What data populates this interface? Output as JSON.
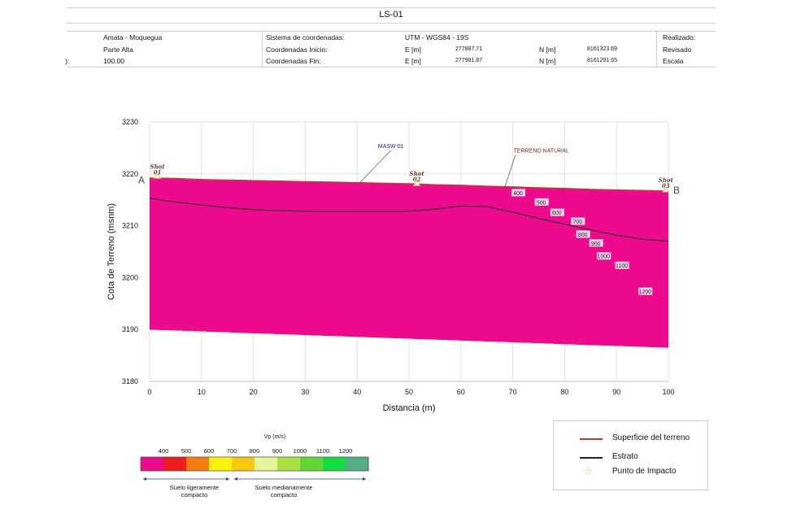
{
  "header": {
    "title": "LS-01",
    "rows": [
      {
        "c1": "",
        "c2": "Amata - Moquegua",
        "c3": "Sistema de coordenadas:",
        "c4": "UTM - WGS84 - 19S",
        "c5": "",
        "c6": "",
        "c7": "",
        "c8": "Realizado:"
      },
      {
        "c1": "",
        "c2": "Parte Alta",
        "c3": "Coordenadas Inicio:",
        "c4": "E [m]",
        "c5": "277887.71",
        "c6": "N [m]",
        "c7": "8161323.69",
        "c8": "Revisado"
      },
      {
        "c1": "):",
        "c2": "100.00",
        "c3": "Coordenadas Fin:",
        "c4": "E [m]",
        "c5": "277981.87",
        "c6": "N [m]",
        "c7": "8161291.65",
        "c8": "Escala"
      }
    ]
  },
  "chart_data": {
    "type": "area",
    "xlabel": "Distancia (m)",
    "ylabel": "Cota de Terreno (msnm)",
    "xlim": [
      0,
      100
    ],
    "ylim": [
      3180,
      3230
    ],
    "x_ticks": [
      "0",
      "10",
      "20",
      "30",
      "40",
      "50",
      "60",
      "70",
      "80",
      "90",
      "100"
    ],
    "y_ticks": [
      "3180",
      "3190",
      "3200",
      "3210",
      "3220",
      "3230"
    ],
    "grid": true,
    "x": [
      0,
      5,
      10,
      15,
      20,
      25,
      30,
      35,
      40,
      45,
      50,
      55,
      60,
      65,
      70,
      75,
      80,
      85,
      90,
      95,
      100
    ],
    "surface": [
      3219.2,
      3219.1,
      3218.9,
      3218.8,
      3218.7,
      3218.6,
      3218.5,
      3218.4,
      3218.3,
      3218.2,
      3218.1,
      3217.9,
      3217.8,
      3217.6,
      3217.5,
      3217.3,
      3217.2,
      3217.0,
      3216.9,
      3216.8,
      3216.7
    ],
    "stratum": [
      3215.3,
      3214.6,
      3214.0,
      3213.5,
      3213.1,
      3212.9,
      3212.8,
      3212.8,
      3212.8,
      3212.8,
      3212.8,
      3213.2,
      3213.8,
      3213.7,
      3212.6,
      3211.4,
      3210.3,
      3209.2,
      3208.2,
      3207.4,
      3207.0
    ],
    "bottom_left": 3190.0,
    "bottom_right": 3186.5,
    "velocity_layers": [
      {
        "vp": 400,
        "color": "#ee0a8c"
      },
      {
        "vp": 500,
        "color": "#ee1c1c"
      },
      {
        "vp": 600,
        "color": "#f57a10"
      },
      {
        "vp": 700,
        "color": "#fbf20a"
      },
      {
        "vp": 800,
        "color": "#f7c80e"
      },
      {
        "vp": 900,
        "color": "#e6f39a"
      },
      {
        "vp": 1000,
        "color": "#a9e23f"
      },
      {
        "vp": 1100,
        "color": "#5fd634"
      },
      {
        "vp": 1200,
        "color": "#14db3e"
      },
      {
        "vp": null,
        "color": "#52ad84"
      }
    ],
    "contour_labels": [
      {
        "text": "400",
        "x": 71,
        "y": 3216.3
      },
      {
        "text": "500",
        "x": 75.5,
        "y": 3214.5
      },
      {
        "text": "600",
        "x": 78.5,
        "y": 3212.5
      },
      {
        "text": "700",
        "x": 82.5,
        "y": 3210.8
      },
      {
        "text": "800",
        "x": 83.5,
        "y": 3208.3
      },
      {
        "text": "900",
        "x": 86,
        "y": 3206.6
      },
      {
        "text": "1000",
        "x": 87.5,
        "y": 3204.1
      },
      {
        "text": "1100",
        "x": 91,
        "y": 3202.3
      },
      {
        "text": "1200",
        "x": 95.5,
        "y": 3197.3
      }
    ],
    "shots": [
      {
        "label": "Shot\n01",
        "x": 1.5,
        "y": 3219.3
      },
      {
        "label": "Shot\n02",
        "x": 51.5,
        "y": 3217.9
      },
      {
        "label": "Shot\n03",
        "x": 99.5,
        "y": 3216.7
      }
    ],
    "annotations": [
      {
        "text": "MASW-01",
        "x": 46.5,
        "y": 3225.0,
        "color": "#1a237e"
      },
      {
        "text": "TERRENO NATURAL",
        "x": 75.5,
        "y": 3224.1,
        "color": "#5d2d21"
      }
    ],
    "profile_ends": [
      "A",
      "B"
    ]
  },
  "colorbar": {
    "title": "Vp (m/s)",
    "ticks": [
      "400",
      "500",
      "600",
      "700",
      "800",
      "900",
      "1000",
      "1100",
      "1200"
    ],
    "class_left": "Suelo ligeramente\ncompacto",
    "class_right": "Suelo medianamente\ncompacto"
  },
  "legend": {
    "surface": {
      "label": "Superficie del terreno",
      "color": "#c0392b"
    },
    "stratum": {
      "label": "Estrato",
      "color": "#222222"
    },
    "impact": {
      "label": "Punto de Impacto",
      "color": "#e8c66a"
    }
  }
}
